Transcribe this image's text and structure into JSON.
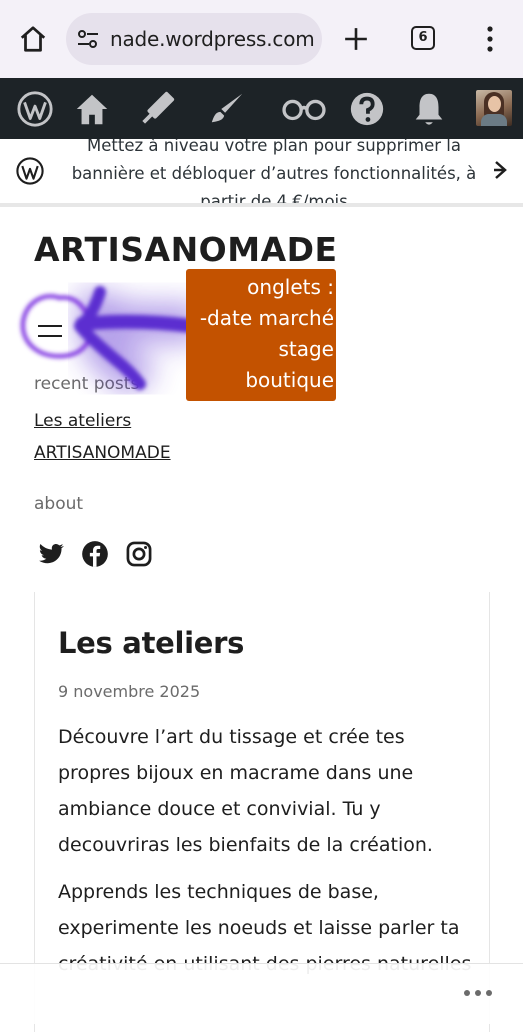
{
  "browser": {
    "url": "nade.wordpress.com",
    "tab_count": "6",
    "icons": [
      "home-icon",
      "site-settings-icon",
      "new-tab-icon",
      "tabs-icon",
      "more-vert-icon"
    ]
  },
  "admin_bar": {
    "icons": [
      "wordpress-icon",
      "my-site-icon",
      "customize-icon",
      "design-icon",
      "reader-icon",
      "help-icon",
      "notifications-icon",
      "avatar"
    ]
  },
  "banner": {
    "text": "Mettez à niveau votre plan pour supprimer la bannière et débloquer d’autres fonctionnalités, à partir de 4 €/mois"
  },
  "site": {
    "title": "ARTISANOMADE",
    "recent_label": "recent posts",
    "recent_posts": [
      "Les ateliers",
      "ARTISANOMADE"
    ],
    "about_label": "about",
    "social": [
      "twitter-icon",
      "facebook-icon",
      "instagram-icon"
    ]
  },
  "post": {
    "title": "Les ateliers",
    "date": "9 novembre 2025",
    "paragraph_1": "Découvre l’art du tissage et crée tes propres bijoux en macrame dans une ambiance douce et convivial. Tu y decouvriras les bienfaits de la création.",
    "paragraph_2": "Apprends les techniques de base, experimente les noeuds et laisse parler ta créativité en utilisant des pierres naturelles"
  },
  "annotation": {
    "lines": [
      "onglets :",
      "-date marché",
      "stage",
      "boutique"
    ],
    "color": "#c35200",
    "scribble_color": "#5b2fd0"
  },
  "colors": {
    "admin_bar": "#1d2327",
    "chrome_bg": "#f4f1f8"
  }
}
